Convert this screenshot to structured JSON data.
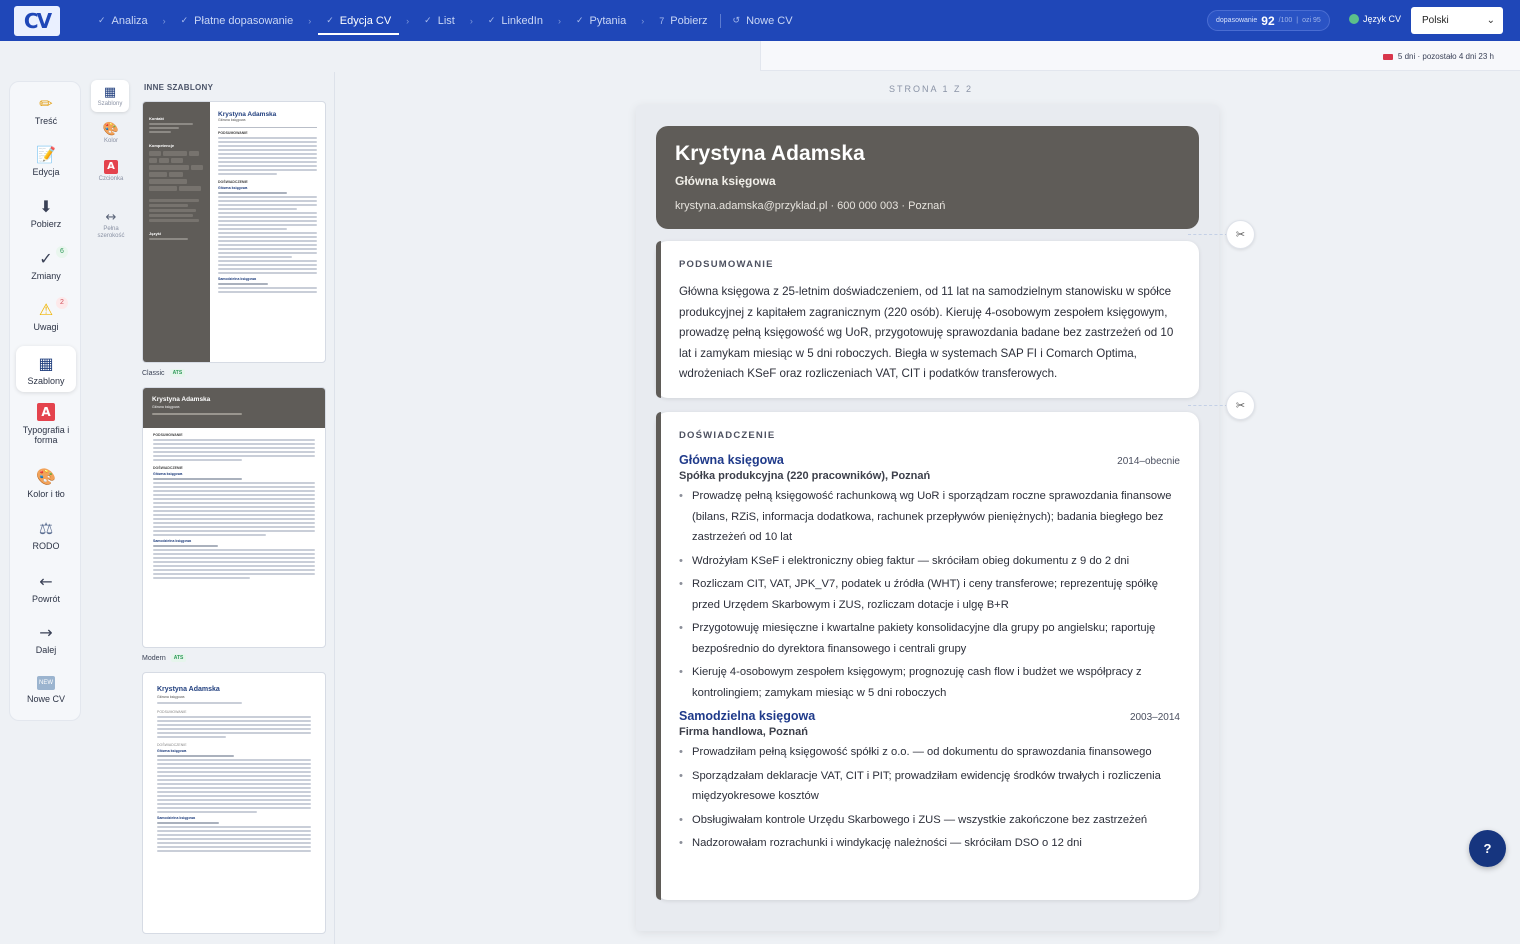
{
  "app": {
    "logo": "CV"
  },
  "steps": [
    {
      "label": "Analiza",
      "icon": "check"
    },
    {
      "label": "Płatne dopasowanie",
      "icon": "check"
    },
    {
      "label": "Edycja CV",
      "icon": "check",
      "active": true
    },
    {
      "label": "List",
      "icon": "check"
    },
    {
      "label": "LinkedIn",
      "icon": "check"
    },
    {
      "label": "Pytania",
      "icon": "check"
    },
    {
      "label": "Pobierz",
      "icon": "7"
    },
    {
      "label": "Nowe CV",
      "icon": "restart"
    }
  ],
  "score": {
    "label": "dopasowanie",
    "value": "92",
    "max": "/100",
    "ats": "ozi 95"
  },
  "language": {
    "label": "Język CV",
    "selected": "Polski"
  },
  "trial": {
    "text": "5 dni · pozostało 4 dni 23 h"
  },
  "rail": [
    {
      "label": "Treść",
      "icon": "pencil"
    },
    {
      "label": "Edycja",
      "icon": "edit"
    },
    {
      "label": "Pobierz",
      "icon": "download"
    },
    {
      "label": "Zmiany",
      "icon": "check",
      "badge": "6"
    },
    {
      "label": "Uwagi",
      "icon": "warning",
      "badge": "2"
    },
    {
      "label": "Szablony",
      "icon": "grid",
      "active": true
    },
    {
      "label": "Typografia i forma",
      "icon": "font"
    },
    {
      "label": "Kolor i tło",
      "icon": "palette"
    },
    {
      "label": "RODO",
      "icon": "scales"
    },
    {
      "label": "Powrót",
      "icon": "arrow-left"
    },
    {
      "label": "Dalej",
      "icon": "arrow-right"
    },
    {
      "label": "Nowe CV",
      "icon": "new",
      "icon_text": "NEW"
    }
  ],
  "mini_rail": [
    {
      "label": "Szablony"
    },
    {
      "label": "Kolor"
    },
    {
      "label": "Czcionka"
    },
    {
      "label": "Pełna szerokość"
    }
  ],
  "templates": {
    "heading": "INNE SZABLONY",
    "items": [
      {
        "label": "Classic",
        "badge": "ATS"
      },
      {
        "label": "Modern",
        "badge": "ATS"
      },
      {
        "label": "",
        "badge": ""
      }
    ],
    "thumb_texts": {
      "classic_sidebar_title": "Kontakt",
      "classic_sidebar_skills": "Kompetencje",
      "classic_sidebar_lang": "Języki",
      "classic_section1": "PODSUMOWANIE",
      "classic_section2": "DOŚWIADCZENIE",
      "job1": "Główna księgowa",
      "job2": "Samodzielna księgowa"
    }
  },
  "page_label": "STRONA 1 Z 2",
  "cv": {
    "name": "Krystyna Adamska",
    "role": "Główna księgowa",
    "contact": "krystyna.adamska@przyklad.pl · 600 000 003 · Poznań",
    "summary_title": "PODSUMOWANIE",
    "summary": "Główna księgowa z 25-letnim doświadczeniem, od 11 lat na samodzielnym stanowisku w spółce produkcyjnej z kapitałem zagranicznym (220 osób). Kieruję 4-osobowym zespołem księgowym, prowadzę pełną księgowość wg UoR, przygotowuję sprawozdania badane bez zastrzeżeń od 10 lat i zamykam miesiąc w 5 dni roboczych. Biegła w systemach SAP FI i Comarch Optima, wdrożeniach KSeF oraz rozliczeniach VAT, CIT i podatków transferowych.",
    "experience_title": "DOŚWIADCZENIE",
    "jobs": [
      {
        "title": "Główna księgowa",
        "dates": "2014–obecnie",
        "company": "Spółka produkcyjna (220 pracowników), Poznań",
        "bullets": [
          "Prowadzę pełną księgowość rachunkową wg UoR i sporządzam roczne sprawozdania finansowe (bilans, RZiS, informacja dodatkowa, rachunek przepływów pieniężnych); badania biegłego bez zastrzeżeń od 10 lat",
          "Wdrożyłam KSeF i elektroniczny obieg faktur — skróciłam obieg dokumentu z 9 do 2 dni",
          "Rozliczam CIT, VAT, JPK_V7, podatek u źródła (WHT) i ceny transferowe; reprezentuję spółkę przed Urzędem Skarbowym i ZUS, rozliczam dotacje i ulgę B+R",
          "Przygotowuję miesięczne i kwartalne pakiety konsolidacyjne dla grupy po angielsku; raportuję bezpośrednio do dyrektora finansowego i centrali grupy",
          "Kieruję 4-osobowym zespołem księgowym; prognozuję cash flow i budżet we współpracy z kontrolingiem; zamykam miesiąc w 5 dni roboczych"
        ]
      },
      {
        "title": "Samodzielna księgowa",
        "dates": "2003–2014",
        "company": "Firma handlowa, Poznań",
        "bullets": [
          "Prowadziłam pełną księgowość spółki z o.o. — od dokumentu do sprawozdania finansowego",
          "Sporządzałam deklaracje VAT, CIT i PIT; prowadziłam ewidencję środków trwałych i rozliczenia międzyokresowe kosztów",
          "Obsługiwałam kontrole Urzędu Skarbowego i ZUS — wszystkie zakończone bez zastrzeżeń",
          "Nadzorowałam rozrachunki i windykację należności — skróciłam DSO o 12 dni"
        ]
      }
    ]
  },
  "help": {
    "label": "?"
  },
  "colors": {
    "topbar": "#1f47b8",
    "header": "#5f5c58",
    "accent": "#1f3a8a",
    "help": "#16357f"
  }
}
